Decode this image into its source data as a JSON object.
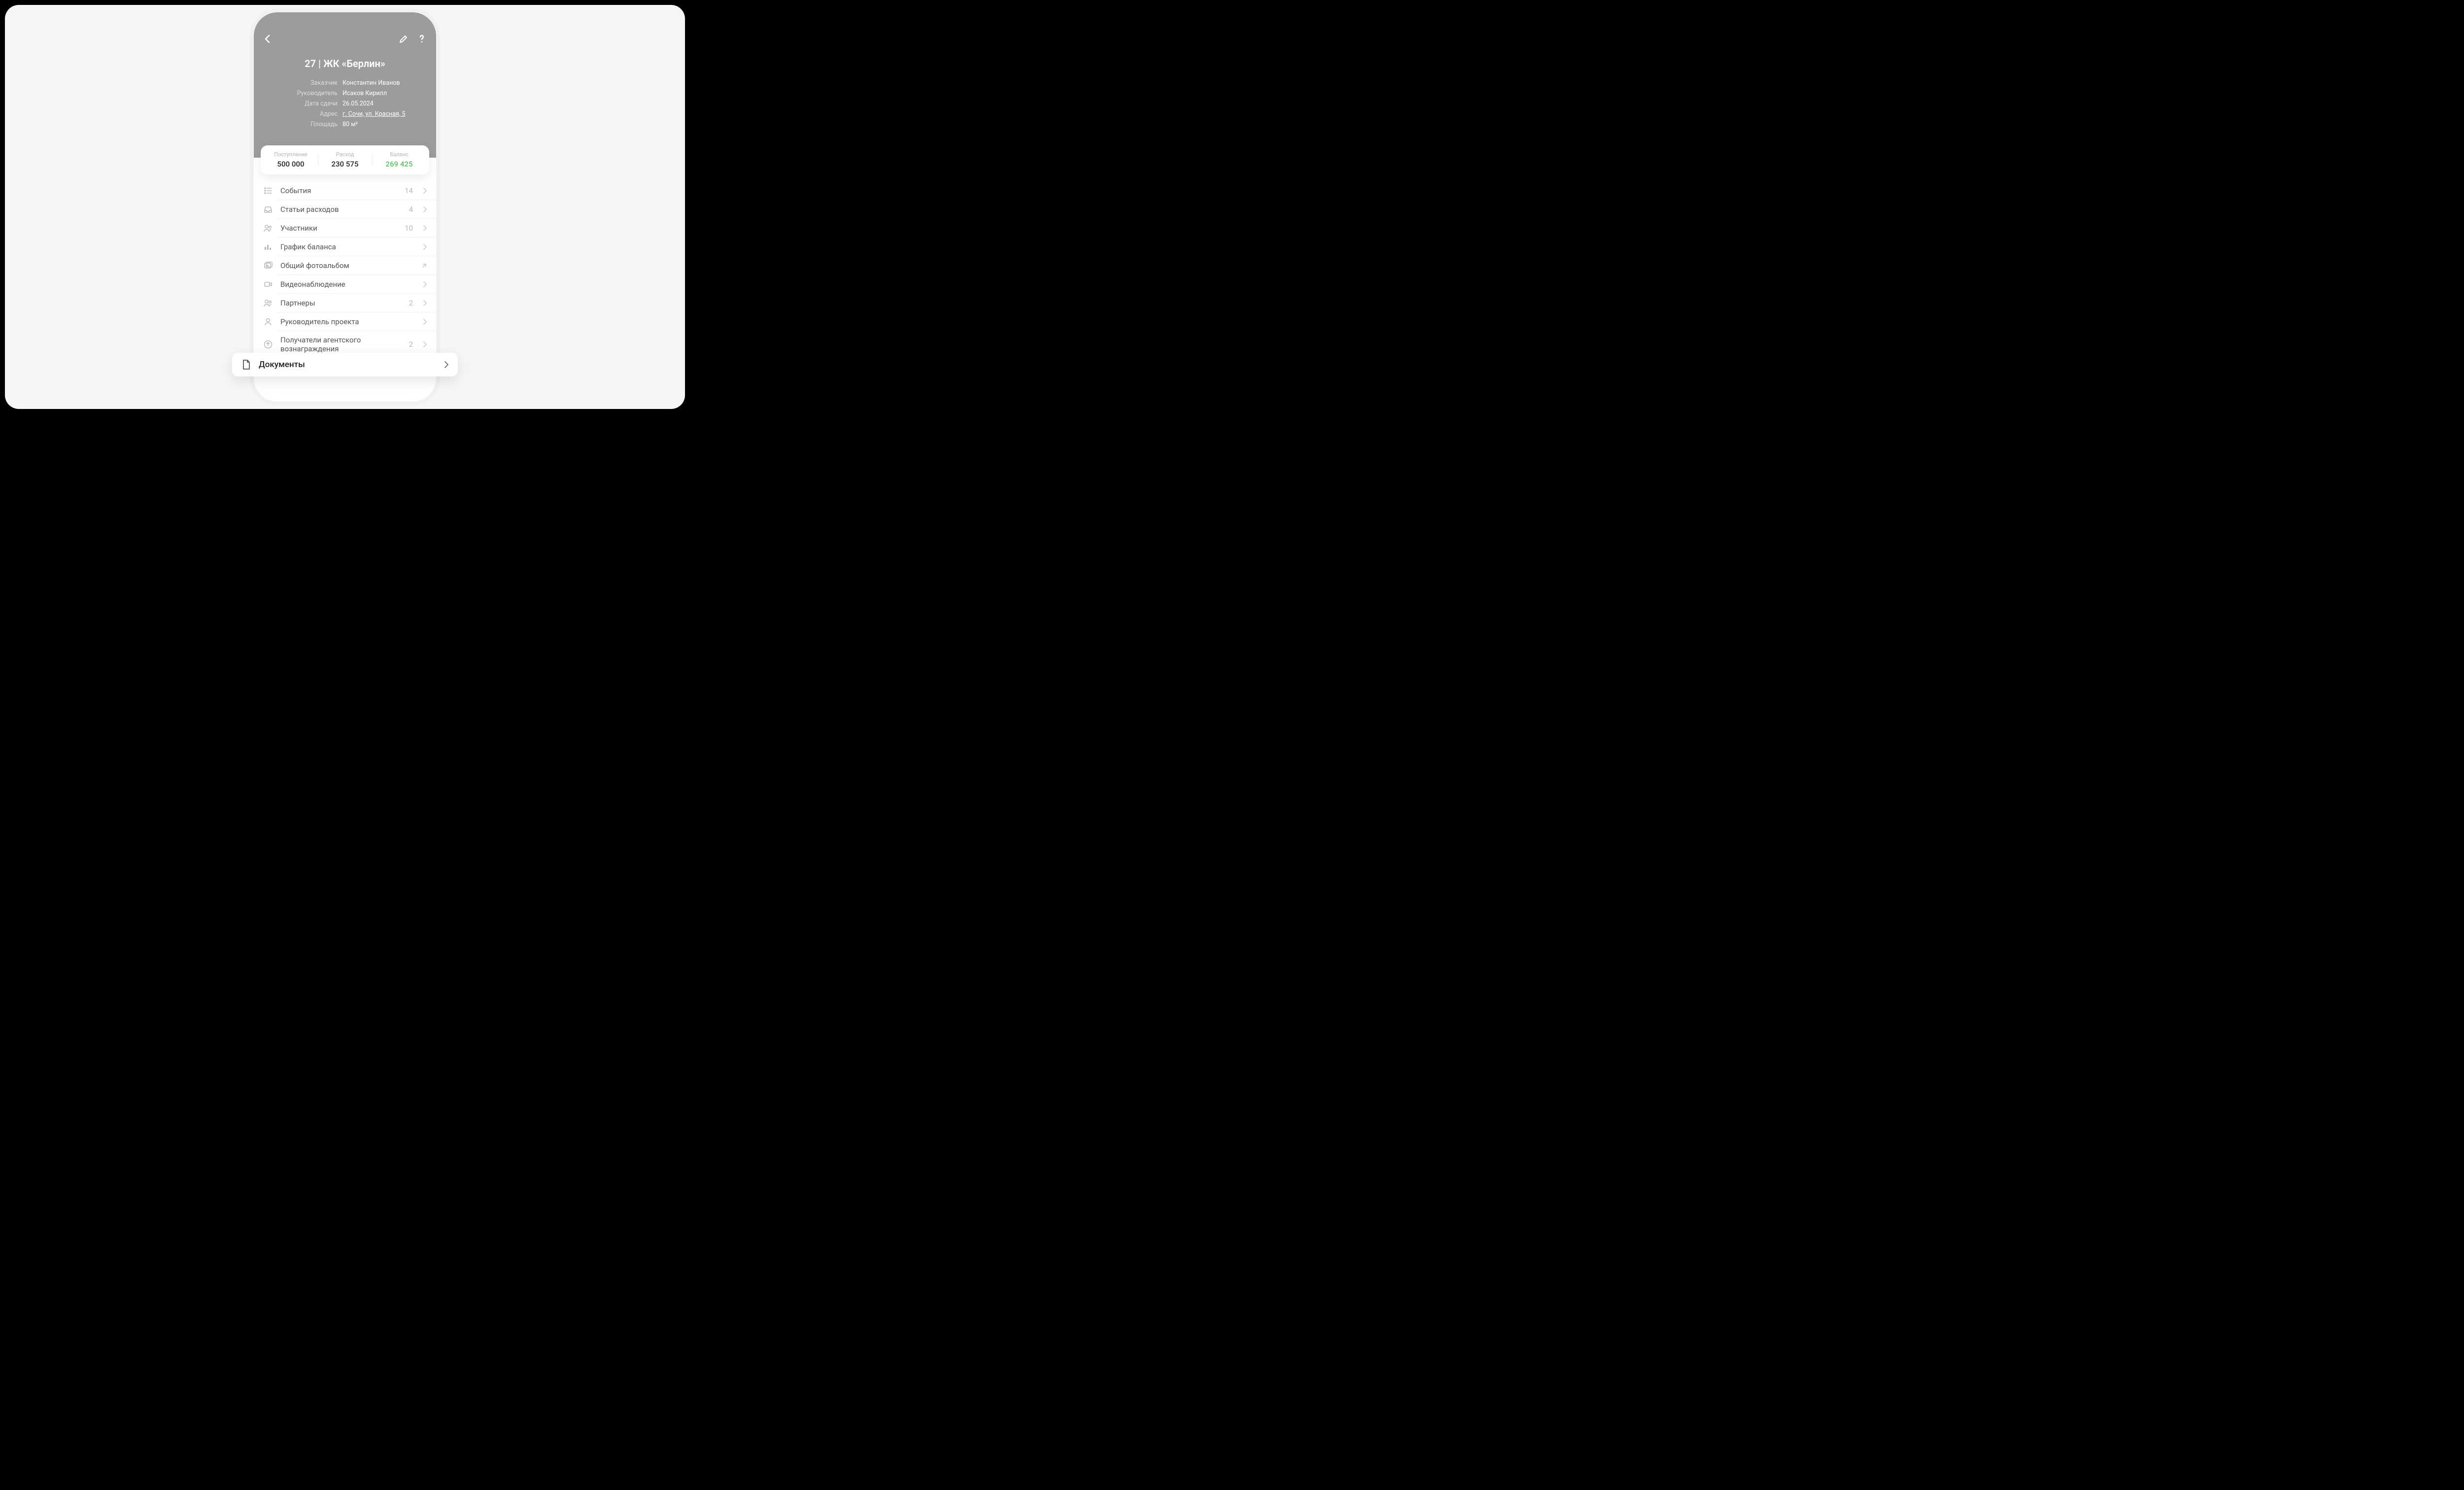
{
  "header": {
    "title": "27 | ЖК «Берлин»",
    "customer_label": "Заказчик",
    "customer_value": "Константин Иванов",
    "manager_label": "Руководитель",
    "manager_value": "Исаков Кирилл",
    "due_label": "Дата сдачи",
    "due_value": "26.05.2024",
    "address_label": "Адрес",
    "address_value": "г. Сочи, ул. Красная, 5",
    "area_label": "Площадь",
    "area_value": "80 м²"
  },
  "balance": {
    "income_label": "Поступление",
    "income_value": "500 000",
    "expense_label": "Расход",
    "expense_value": "230 575",
    "balance_label": "Баланс",
    "balance_value": "269 425"
  },
  "menu": {
    "events_label": "События",
    "events_count": "14",
    "categories_label": "Статьи расходов",
    "categories_count": "4",
    "participants_label": "Участники",
    "participants_count": "10",
    "chart_label": "График баланса",
    "photos_label": "Общий фотоальбом",
    "cctv_label": "Видеонаблюдение",
    "partners_label": "Партнеры",
    "partners_count": "2",
    "pm_label": "Руководитель проекта",
    "agents_label": "Получатели агентского вознаграждения",
    "agents_count": "2",
    "documents_label": "Документы"
  }
}
